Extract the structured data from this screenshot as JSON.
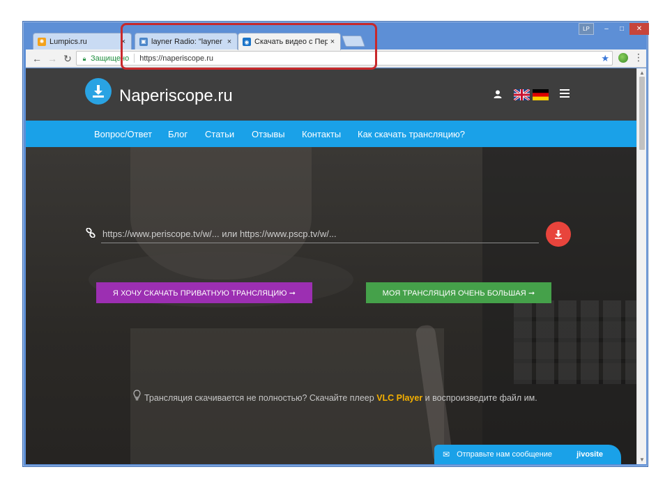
{
  "browser": {
    "user_badge": "LP",
    "tabs": [
      {
        "label": "Lumpics.ru",
        "close": "×"
      },
      {
        "label": "layner Radio: \"layner Radi",
        "close": "×"
      },
      {
        "label": "Скачать видео с Периск",
        "close": "×"
      }
    ],
    "controls": {
      "back": "←",
      "forward": "→",
      "reload": "↻",
      "minimize": "–",
      "maximize": "□",
      "close": "✕"
    },
    "address_bar": {
      "secure_label": "Защищено",
      "url": "https://naperiscope.ru"
    },
    "colors": {
      "accent_highlight": "#c8282b"
    }
  },
  "site": {
    "logo_text": "Naperiscope.ru",
    "nav": [
      "Вопрос/Ответ",
      "Блог",
      "Статьи",
      "Отзывы",
      "Контакты",
      "Как скачать трансляцию?"
    ],
    "input_placeholder": "https://www.periscope.tv/w/... или https://www.pscp.tv/w/...",
    "buttons": {
      "private": "Я ХОЧУ СКАЧАТЬ ПРИВАТНУЮ ТРАНСЛЯЦИЮ ➞",
      "large": "МОЯ ТРАНСЛЯЦИЯ ОЧЕНЬ БОЛЬШАЯ ➞"
    },
    "tip": {
      "before": "Трансляция скачивается не полностью? Скачайте плеер ",
      "highlight": "VLC Player",
      "after": " и воспроизведите файл им."
    },
    "chat": {
      "message": "Отправьте нам сообщение",
      "brand": "jivosite"
    },
    "colors": {
      "header": "#3e3e3e",
      "nav": "#1aa1e8",
      "private_btn": "#9c2fb2",
      "large_btn": "#45a14a",
      "download_btn": "#e8443c",
      "tip_highlight": "#f5b000"
    }
  }
}
